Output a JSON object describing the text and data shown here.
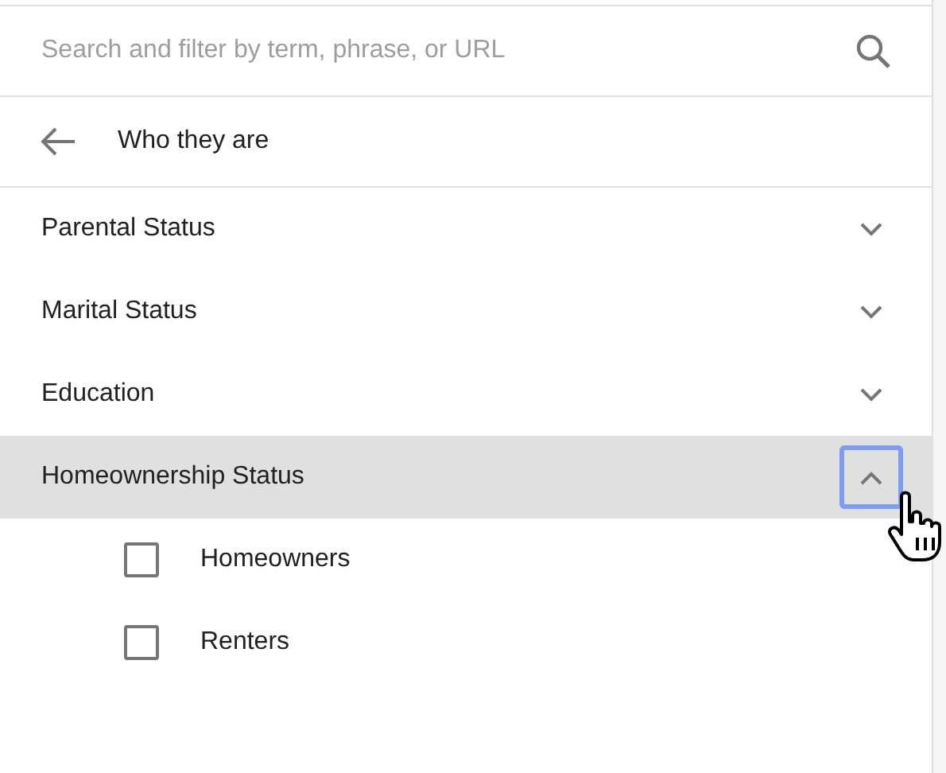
{
  "search": {
    "placeholder": "Search and filter by term, phrase, or URL"
  },
  "header": {
    "title": "Who they are"
  },
  "categories": [
    {
      "label": "Parental Status",
      "expanded": false,
      "selected": false,
      "focused": false
    },
    {
      "label": "Marital Status",
      "expanded": false,
      "selected": false,
      "focused": false
    },
    {
      "label": "Education",
      "expanded": false,
      "selected": false,
      "focused": false
    },
    {
      "label": "Homeownership Status",
      "expanded": true,
      "selected": true,
      "focused": true,
      "children": [
        {
          "label": "Homeowners",
          "checked": false
        },
        {
          "label": "Renters",
          "checked": false
        }
      ]
    }
  ]
}
